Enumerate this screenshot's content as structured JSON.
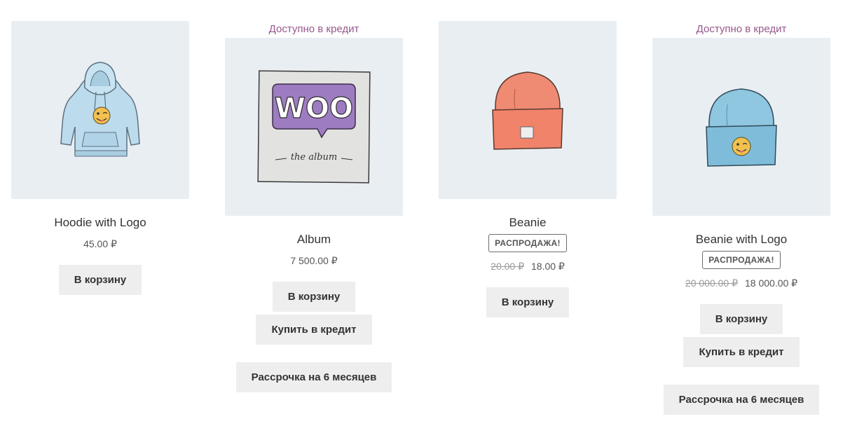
{
  "products": [
    {
      "credit_note": "",
      "title": "Hoodie with Logo",
      "sale_badge": "",
      "price": "45.00 ₽",
      "old_price": "",
      "buttons": {
        "cart": "В корзину",
        "credit": "",
        "installment": ""
      },
      "icon": "hoodie-with-logo-image"
    },
    {
      "credit_note": "Доступно в кредит",
      "title": "Album",
      "sale_badge": "",
      "price": "7 500.00 ₽",
      "old_price": "",
      "buttons": {
        "cart": "В корзину",
        "credit": "Купить в кредит",
        "installment": "Рассрочка на 6 месяцев"
      },
      "icon": "woo-album-image",
      "image_text": {
        "logo": "WOO",
        "caption": "the album"
      }
    },
    {
      "credit_note": "",
      "title": "Beanie",
      "sale_badge": "РАСПРОДАЖА!",
      "price": "18.00 ₽",
      "old_price": "20.00 ₽",
      "buttons": {
        "cart": "В корзину",
        "credit": "",
        "installment": ""
      },
      "icon": "orange-beanie-image"
    },
    {
      "credit_note": "Доступно в кредит",
      "title": "Beanie with Logo",
      "sale_badge": "РАСПРОДАЖА!",
      "price": "18 000.00 ₽",
      "old_price": "20 000.00 ₽",
      "buttons": {
        "cart": "В корзину",
        "credit": "Купить в кредит",
        "installment": "Рассрочка на 6 месяцев"
      },
      "icon": "blue-beanie-with-logo-image"
    }
  ],
  "colors": {
    "credit_note": "#96588a",
    "thumb_bg": "#e9eef2",
    "button_bg": "#eeeeee"
  }
}
